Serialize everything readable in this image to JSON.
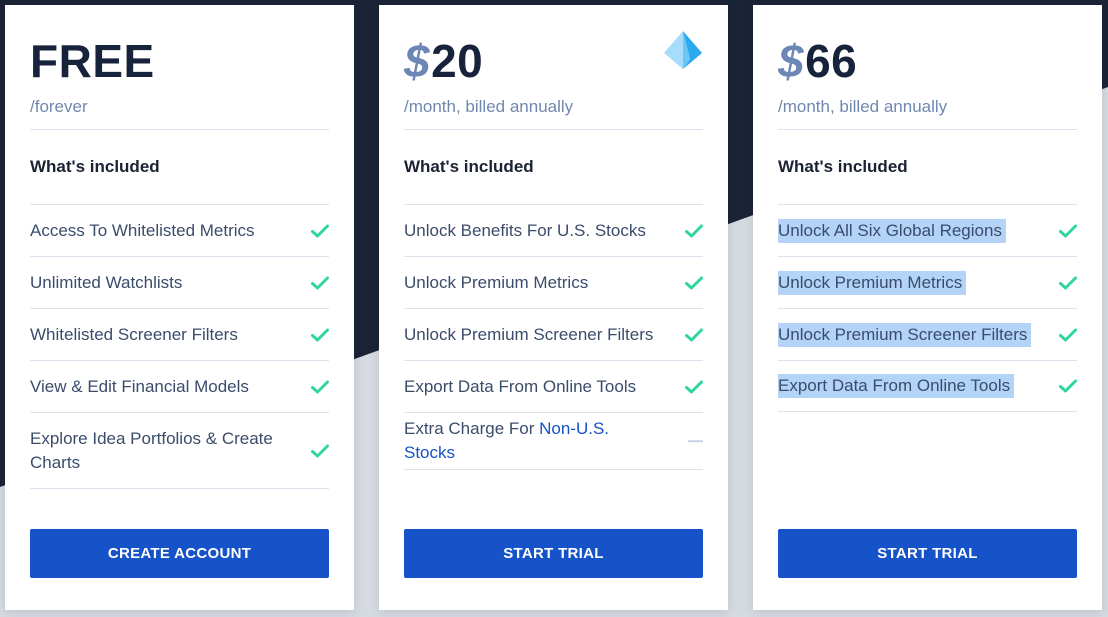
{
  "colors": {
    "background_dark": "#1a2436",
    "background_light": "#d6dae1",
    "accent_blue": "#1652c8",
    "check_green": "#2fd6a0",
    "price_text": "#17233a",
    "currency_symbol": "#6c86b5",
    "highlight": "#b3d4f7"
  },
  "plans": [
    {
      "currency": "",
      "price": "FREE",
      "period": "/forever",
      "heading": "What's included",
      "badge_icon": null,
      "features": [
        {
          "text": "Access To Whitelisted Metrics",
          "status": "check"
        },
        {
          "text": "Unlimited Watchlists",
          "status": "check"
        },
        {
          "text": "Whitelisted Screener Filters",
          "status": "check"
        },
        {
          "text": "View & Edit Financial Models",
          "status": "check"
        },
        {
          "text": "Explore Idea Portfolios & Create Charts",
          "status": "check"
        }
      ],
      "cta_label": "CREATE ACCOUNT"
    },
    {
      "currency": "$",
      "price": "20",
      "period": "/month, billed annually",
      "heading": "What's included",
      "badge_icon": "pyramid-gem-icon",
      "features": [
        {
          "text": "Unlock Benefits For U.S. Stocks",
          "status": "check"
        },
        {
          "text": "Unlock Premium Metrics",
          "status": "check"
        },
        {
          "text": "Unlock Premium Screener Filters",
          "status": "check"
        },
        {
          "text": "Export Data From Online Tools",
          "status": "check"
        },
        {
          "text_prefix": "Extra Charge For ",
          "link_text": "Non-U.S. Stocks",
          "status": "dash"
        }
      ],
      "cta_label": "START TRIAL"
    },
    {
      "currency": "$",
      "price": "66",
      "period": "/month, billed annually",
      "heading": "What's included",
      "badge_icon": null,
      "features": [
        {
          "text": "Unlock All Six Global Regions",
          "status": "check",
          "selected": true
        },
        {
          "text": "Unlock Premium Metrics",
          "status": "check",
          "selected": true
        },
        {
          "text": "Unlock Premium Screener Filters",
          "status": "check",
          "selected": true
        },
        {
          "text": "Export Data From Online Tools",
          "status": "check",
          "selected": true
        }
      ],
      "cta_label": "START TRIAL"
    }
  ]
}
